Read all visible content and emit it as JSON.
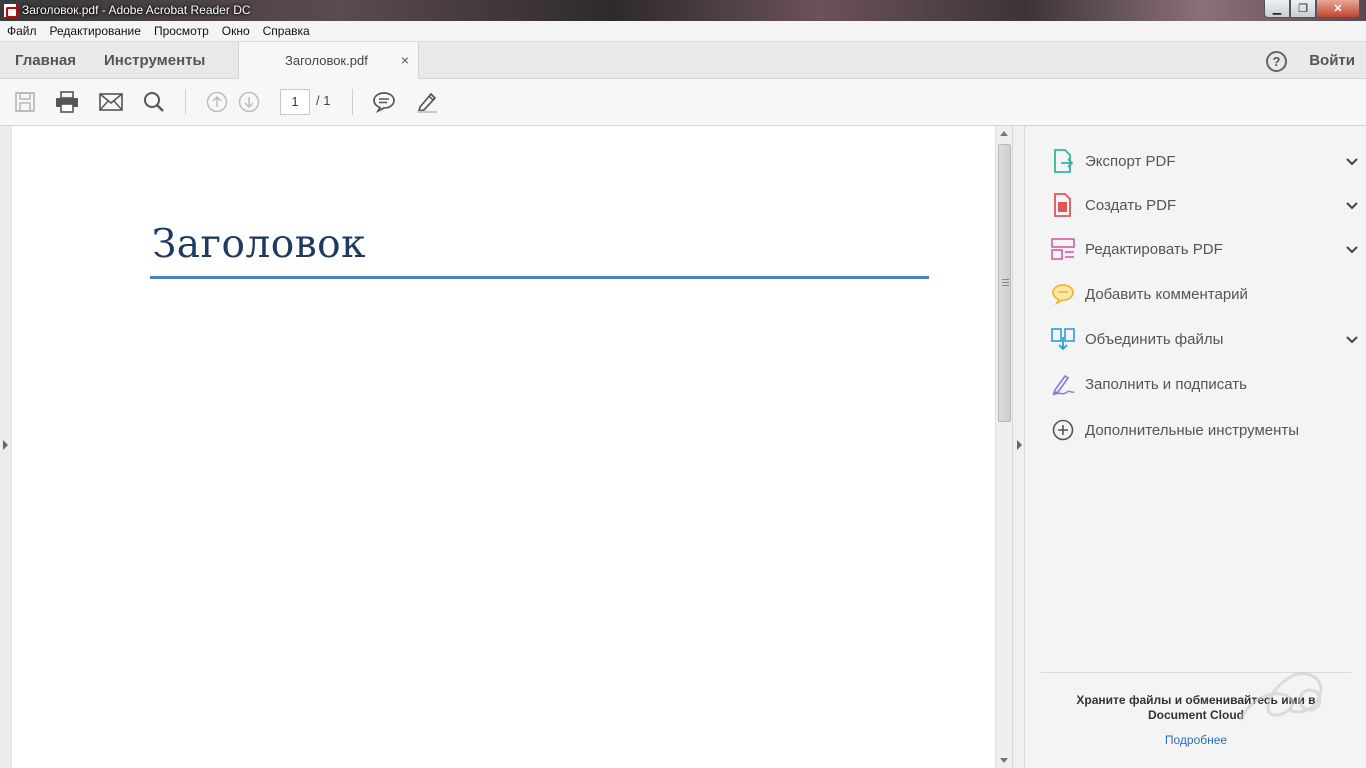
{
  "window": {
    "title": "Заголовок.pdf - Adobe Acrobat Reader DC",
    "minimize": "▁",
    "maximize": "❐",
    "close": "✕"
  },
  "menu": [
    "Файл",
    "Редактирование",
    "Просмотр",
    "Окно",
    "Справка"
  ],
  "tabs": {
    "home": "Главная",
    "tools": "Инструменты",
    "document": "Заголовок.pdf",
    "close": "×",
    "help": "?",
    "signin": "Войти"
  },
  "toolbar": {
    "icons": [
      "save-icon",
      "print-icon",
      "email-icon",
      "search-icon",
      "page-up-icon",
      "page-down-icon",
      "comment-icon",
      "highlight-pen-icon"
    ],
    "page_current": "1",
    "page_total": "/ 1"
  },
  "document": {
    "heading": "Заголовок",
    "rule_color": "#4f81bd",
    "heading_color": "#1f3a5f"
  },
  "right_panel": {
    "items": [
      {
        "label": "Экспорт PDF",
        "icon": "export-pdf-icon",
        "color": "#2fb5a0",
        "expandable": true
      },
      {
        "label": "Создать PDF",
        "icon": "create-pdf-icon",
        "color": "#e0574f",
        "expandable": true
      },
      {
        "label": "Редактировать PDF",
        "icon": "edit-pdf-icon",
        "color": "#d45ca6",
        "expandable": true
      },
      {
        "label": "Добавить комментарий",
        "icon": "comment-icon",
        "color": "#f2b134",
        "expandable": false
      },
      {
        "label": "Объединить файлы",
        "icon": "combine-files-icon",
        "color": "#2a9fd6",
        "expandable": true
      },
      {
        "label": "Заполнить и подписать",
        "icon": "fill-sign-icon",
        "color": "#8c7ad6",
        "expandable": false
      },
      {
        "label": "Дополнительные инструменты",
        "icon": "more-tools-icon",
        "color": "#555555",
        "expandable": false
      }
    ],
    "cloud_text": "Храните файлы и обменивайтесь ими в Document Cloud",
    "cloud_link": "Подробнее"
  }
}
